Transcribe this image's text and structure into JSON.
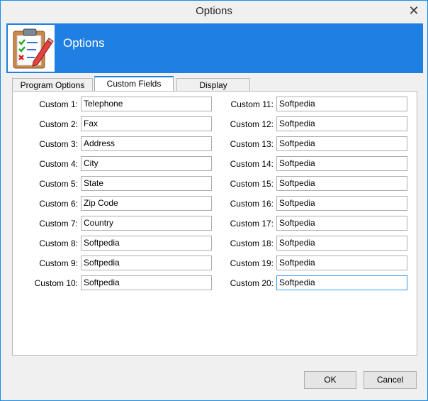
{
  "window": {
    "title": "Options",
    "close_glyph": "✕"
  },
  "banner": {
    "heading": "Options",
    "icon": "clipboard-checklist-icon"
  },
  "tabs": [
    {
      "label": "Program Options",
      "selected": false
    },
    {
      "label": "Custom Fields",
      "selected": true
    },
    {
      "label": "Display",
      "selected": false
    }
  ],
  "fields_left": [
    {
      "label": "Custom 1:",
      "value": "Telephone"
    },
    {
      "label": "Custom 2:",
      "value": "Fax"
    },
    {
      "label": "Custom 3:",
      "value": "Address"
    },
    {
      "label": "Custom 4:",
      "value": "City"
    },
    {
      "label": "Custom 5:",
      "value": "State"
    },
    {
      "label": "Custom 6:",
      "value": "Zip Code"
    },
    {
      "label": "Custom 7:",
      "value": "Country"
    },
    {
      "label": "Custom 8:",
      "value": "Softpedia"
    },
    {
      "label": "Custom 9:",
      "value": "Softpedia"
    },
    {
      "label": "Custom 10:",
      "value": "Softpedia"
    }
  ],
  "fields_right": [
    {
      "label": "Custom 11:",
      "value": "Softpedia"
    },
    {
      "label": "Custom 12:",
      "value": "Softpedia"
    },
    {
      "label": "Custom 13:",
      "value": "Softpedia"
    },
    {
      "label": "Custom 14:",
      "value": "Softpedia"
    },
    {
      "label": "Custom 15:",
      "value": "Softpedia"
    },
    {
      "label": "Custom 16:",
      "value": "Softpedia"
    },
    {
      "label": "Custom 17:",
      "value": "Softpedia"
    },
    {
      "label": "Custom 18:",
      "value": "Softpedia"
    },
    {
      "label": "Custom 19:",
      "value": "Softpedia"
    },
    {
      "label": "Custom 20:",
      "value": "Softpedia"
    }
  ],
  "buttons": {
    "ok": "OK",
    "cancel": "Cancel"
  },
  "colors": {
    "accent": "#1f7fe3",
    "focus": "#3399ff"
  }
}
